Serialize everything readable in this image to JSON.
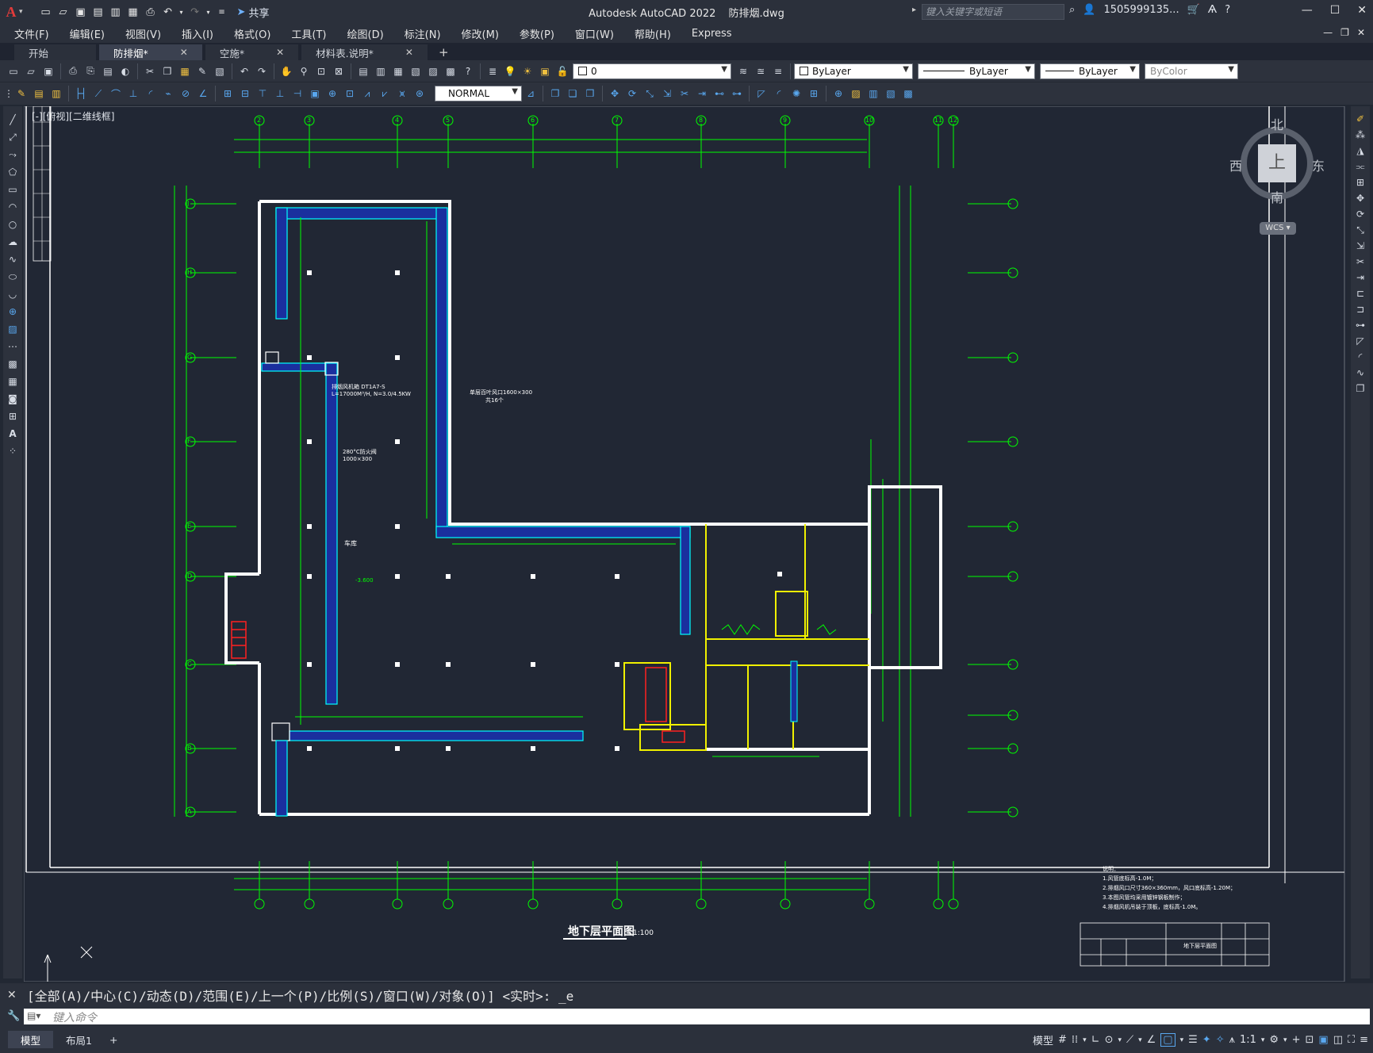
{
  "app": {
    "title": "Autodesk AutoCAD 2022",
    "filename": "防排烟.dwg",
    "share_label": "共享",
    "search_placeholder": "键入关键字或短语",
    "user": "1505999135...",
    "logo_letter": "A"
  },
  "menus": [
    "文件(F)",
    "编辑(E)",
    "视图(V)",
    "插入(I)",
    "格式(O)",
    "工具(T)",
    "绘图(D)",
    "标注(N)",
    "修改(M)",
    "参数(P)",
    "窗口(W)",
    "帮助(H)",
    "Express"
  ],
  "tabs": [
    {
      "label": "开始",
      "active": false,
      "closable": false
    },
    {
      "label": "防排烟*",
      "active": true,
      "closable": true
    },
    {
      "label": "空施*",
      "active": false,
      "closable": true
    },
    {
      "label": "材料表.说明*",
      "active": false,
      "closable": true
    }
  ],
  "toolbar": {
    "layer_value": "0",
    "color_value": "ByLayer",
    "linetype_value": "ByLayer",
    "lineweight_value": "ByLayer",
    "plotstyle_value": "ByColor",
    "dimstyle_value": "NORMAL"
  },
  "viewport": {
    "label": "[-][俯视][二维线框]",
    "viewcube": {
      "north": "北",
      "south": "南",
      "east": "东",
      "west": "西",
      "face": "上",
      "wcs": "WCS"
    }
  },
  "drawing": {
    "grid_top": [
      "2",
      "3",
      "4",
      "5",
      "6",
      "7",
      "8",
      "9",
      "10",
      "11",
      "12"
    ],
    "grid_left": [
      "J",
      "H",
      "G",
      "F",
      "E",
      "D",
      "C",
      "B",
      "A"
    ],
    "grid_right": [
      "J",
      "H",
      "G",
      "F",
      "E",
      "D",
      "C",
      "B",
      "A"
    ],
    "plan_title": "地下层平面图",
    "plan_scale": "1:100",
    "room_car": "车库",
    "elev_main": "-3.600",
    "fan_label_1": "排烟风机箱 DT1A7-S",
    "fan_label_2": "L=17000M³/H, N=3.0/4.5KW",
    "outlet_label": "单层百叶风口1600×300",
    "outlet_count": "共16个",
    "damper_label": "280°C防火阀",
    "damper_size": "1000×300",
    "notes_title": "说明：",
    "notes": [
      "1.风管底标高-1.0M；",
      "2.排烟风口尺寸360×360mm，风口底标高-1.20M；",
      "3.本图风管均采用镀锌钢板制作；",
      "4.排烟风机吊装于顶板，底标高-1.0M。"
    ],
    "titleblock_name": "地下层平面图"
  },
  "command": {
    "history": "[全部(A)/中心(C)/动态(D)/范围(E)/上一个(P)/比例(S)/窗口(W)/对象(O)] <实时>: _e",
    "placeholder": "键入命令"
  },
  "status": {
    "model_tab": "模型",
    "layout_tab": "布局1",
    "model_button": "模型",
    "scale": "1:1"
  }
}
